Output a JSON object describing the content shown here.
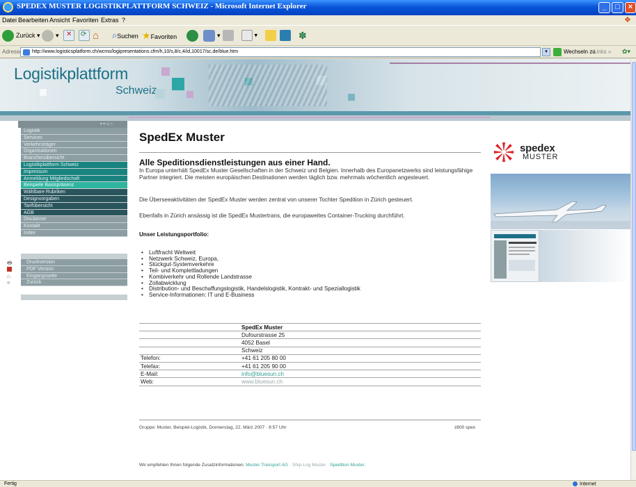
{
  "window": {
    "title": "SPEDEX MUSTER LOGISTIKPLATTFORM SCHWEIZ - Microsoft Internet Explorer"
  },
  "menu": [
    "Datei",
    "Bearbeiten",
    "Ansicht",
    "Favoriten",
    "Extras",
    "?"
  ],
  "toolbar": {
    "back": "Zurück",
    "search": "Suchen",
    "favorites": "Favoriten"
  },
  "address": {
    "label": "Adresse",
    "url": "http://www.logisticsplatform.ch/wcms/logipresentations.cfm/h,10/s,8/c,4/id,10017/sc,de/blue.htm",
    "go": "Wechseln zu",
    "links": "Links"
  },
  "site": {
    "logo_line1": "Logistikplattform",
    "logo_line2": "Schweiz"
  },
  "nav": [
    {
      "label": "Logistik",
      "style": "gray"
    },
    {
      "label": "Services",
      "style": "gray"
    },
    {
      "label": "Verkehrsträger",
      "style": "gray"
    },
    {
      "label": "Organisationen",
      "style": "gray"
    },
    {
      "label": "Branchenübersicht",
      "style": "gray"
    },
    {
      "label": "Logistikplattform Schweiz",
      "style": "teal"
    },
    {
      "label": "Impressum",
      "style": "teal"
    },
    {
      "label": "Anmeldung Mitgliedschaft",
      "style": "teal"
    },
    {
      "label": "Beispiele Basispräsenz",
      "style": "mint"
    },
    {
      "label": "Wählbare Rubriken",
      "style": "dark"
    },
    {
      "label": "Designvorgaben",
      "style": "dark"
    },
    {
      "label": "Tarifübersicht",
      "style": "dark"
    },
    {
      "label": "AGB",
      "style": "dark"
    },
    {
      "label": "Disclaimer",
      "style": "gray"
    },
    {
      "label": "Kontakt",
      "style": "gray"
    },
    {
      "label": "Index",
      "style": "gray"
    }
  ],
  "util": [
    "Druckversion",
    "PDF Version",
    "Eingangsseite",
    "Zurück"
  ],
  "main": {
    "title": "SpedEx Muster",
    "subtitle": "Alle Speditionsdienstleistungen aus einer Hand.",
    "para1": "In Europa unterhält SpedEx Muster Gesellschaften in der Schweiz und Belgien. Innerhalb des Europanetzwerks sind leistungsfähige Partner integriert. Die meisten europäischen Destinationen werden täglich bzw. mehrmals wöchentlich angesteuert.",
    "para2": "Die Überseeaktivitäten der SpedEx Muster werden zentral von unserer Tochter Spedition in Zürich gesteuert.",
    "para3": "Ebenfalls in Zürich ansässig ist die SpedEx Mustertrans, die europaweites Container-Trucking durchführt.",
    "portfolio_label": "Unser Leistungsportfolio:",
    "services": [
      "Luftfracht Weltweit",
      "Netzwerk Schweiz, Europa,",
      "Stückgut-Systemverkehre",
      "Teil- und Komplettladungen",
      "Kombiverkehr und Rollende Landstrasse",
      "Zollabwicklung",
      "Distribution- und Beschaffungslogistik, Handelslogistik, Kontrakt- und Speziallogistik",
      "Service-Informationen: IT und E-Business"
    ],
    "contact": [
      {
        "label": "",
        "value": "SpedEx Muster",
        "kind": "bold"
      },
      {
        "label": "",
        "value": "Dufourstrasse 25",
        "kind": "plain"
      },
      {
        "label": "",
        "value": "4052 Basel",
        "kind": "plain"
      },
      {
        "label": "",
        "value": "Schweiz",
        "kind": "plain"
      },
      {
        "label": "Telefon:",
        "value": "+41 61 205 80 00",
        "kind": "plain"
      },
      {
        "label": "Telefax:",
        "value": "+41 61 205 90 00",
        "kind": "plain"
      },
      {
        "label": "E-Mail:",
        "value": "info@bluesun.ch",
        "kind": "link"
      },
      {
        "label": "Web:",
        "value": "www.bluesun.ch",
        "kind": "muted"
      }
    ],
    "footer_left": "Gruppe: Muster, Beispiel-Logistik, Donnerstag, 22. März 2007 · 8:57 Uhr",
    "footer_right": "z800 spex",
    "recommend_prefix": "Wir empfehlen Ihnen folgende Zusatzinformationen:",
    "recommend_links": [
      "Muster Transport AG",
      "Ship-Log Muster",
      "Spedition Muster."
    ]
  },
  "brand": {
    "name": "spedex",
    "sub": "MUSTER"
  },
  "status": {
    "left": "Fertig",
    "zone": "Internet"
  },
  "colors": {
    "accent_teal": "#19847f",
    "link": "#2f9f94",
    "brand_red": "#d8262c"
  }
}
